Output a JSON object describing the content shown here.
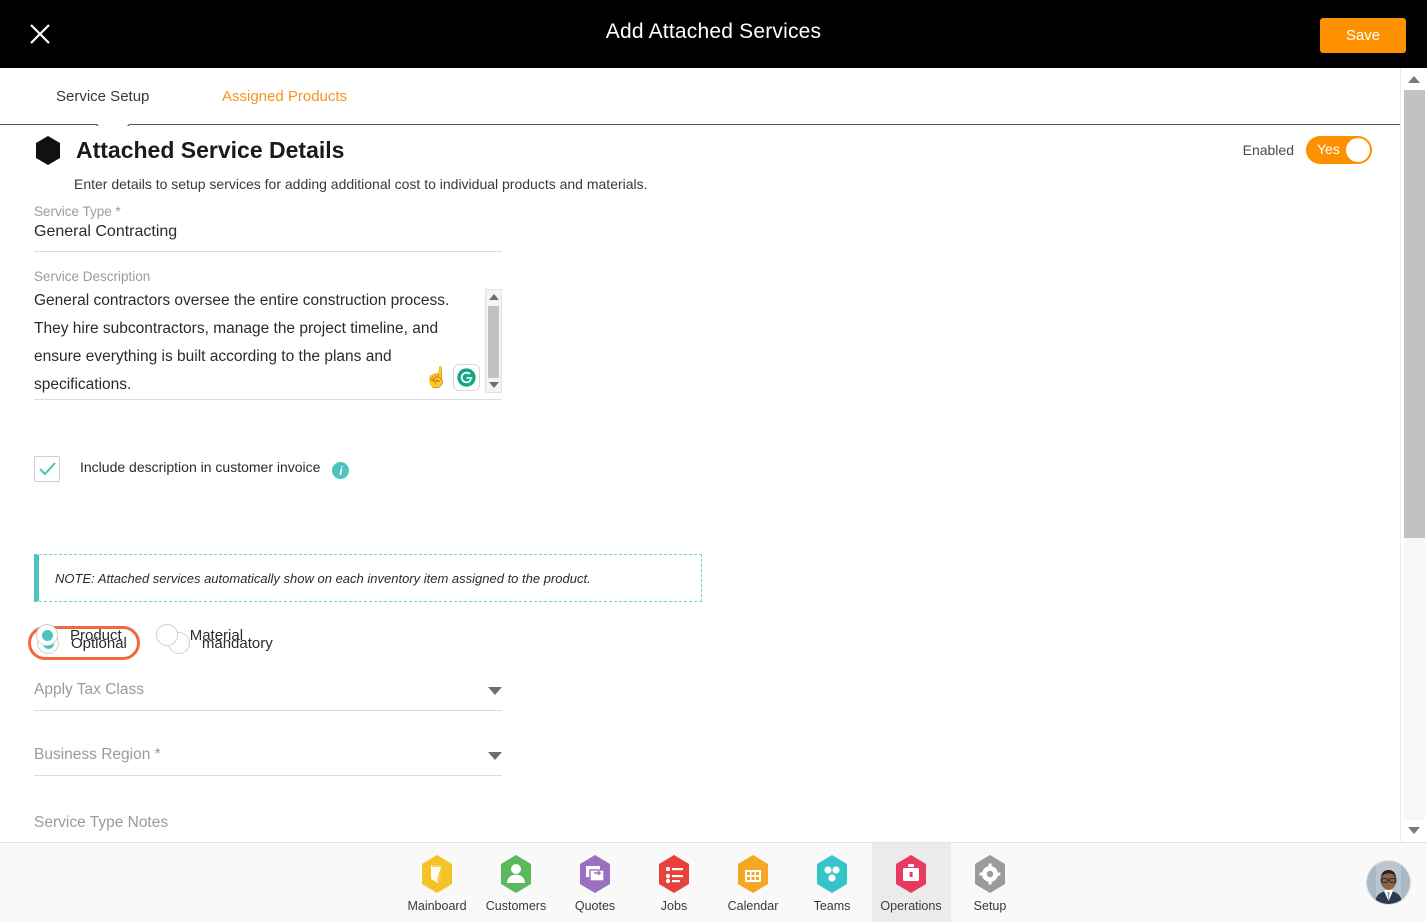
{
  "header": {
    "title": "Add Attached Services",
    "close_icon": "close-icon",
    "save_label": "Save"
  },
  "tabs": [
    {
      "label": "Service Setup",
      "active": true
    },
    {
      "label": "Assigned Products",
      "active": false
    }
  ],
  "section": {
    "title": "Attached Service Details",
    "subtitle": "Enter details to setup services for adding additional cost to individual products and materials.",
    "marker_icon": "hexagon-icon"
  },
  "enabled": {
    "label": "Enabled",
    "toggle_value": "Yes",
    "state": "on",
    "color": "#FF9100"
  },
  "fields": {
    "service_type": {
      "label": "Service Type *",
      "value": "General Contracting"
    },
    "service_description": {
      "label": "Service Description",
      "value": "General contractors oversee the entire construction process. They hire subcontractors, manage the project timeline, and ensure everything is built according to the plans and specifications.",
      "assistant_icons": [
        "pointing-hand-icon",
        "grammarly-icon"
      ]
    },
    "service_type_notes": {
      "label": "Service Type Notes",
      "value": ""
    }
  },
  "include_description": {
    "label": "Include description in customer invoice",
    "checked": true,
    "info_icon": "info-icon",
    "check_color": "#4DC3BE"
  },
  "requirement_radios": {
    "options": [
      {
        "label": "Optional",
        "selected": true,
        "highlighted": true
      },
      {
        "label": "mandatory",
        "selected": false,
        "highlighted": false
      }
    ],
    "highlight_color": "#F4693B",
    "selected_color": "#4DC3BE"
  },
  "note": {
    "text": "NOTE: Attached services automatically show on each inventory item assigned to the product.",
    "accent_color": "#4DC3BE"
  },
  "applies_to_radios": {
    "options": [
      {
        "label": "Product",
        "selected": true
      },
      {
        "label": "Material",
        "selected": false
      }
    ]
  },
  "selects": {
    "tax_class": {
      "label": "Apply Tax Class",
      "value": "",
      "caret_icon": "chevron-down-icon"
    },
    "business_region": {
      "label": "Business Region *",
      "value": "",
      "caret_icon": "chevron-down-icon"
    }
  },
  "bottom_nav": {
    "items": [
      {
        "label": "Mainboard",
        "icon": "mainboard-icon",
        "color": "#F5C327",
        "active": false
      },
      {
        "label": "Customers",
        "icon": "person-icon",
        "color": "#5CB85C",
        "active": false
      },
      {
        "label": "Quotes",
        "icon": "quotes-icon",
        "color": "#9B6FC0",
        "active": false
      },
      {
        "label": "Jobs",
        "icon": "list-icon",
        "color": "#E8403A",
        "active": false
      },
      {
        "label": "Calendar",
        "icon": "calendar-icon",
        "color": "#F5A623",
        "active": false
      },
      {
        "label": "Teams",
        "icon": "teams-icon",
        "color": "#35C4C9",
        "active": false
      },
      {
        "label": "Operations",
        "icon": "briefcase-icon",
        "color": "#E83A5F",
        "active": true
      },
      {
        "label": "Setup",
        "icon": "gear-icon",
        "color": "#9B9B9B",
        "active": false
      }
    ],
    "avatar_icon": "user-avatar"
  }
}
